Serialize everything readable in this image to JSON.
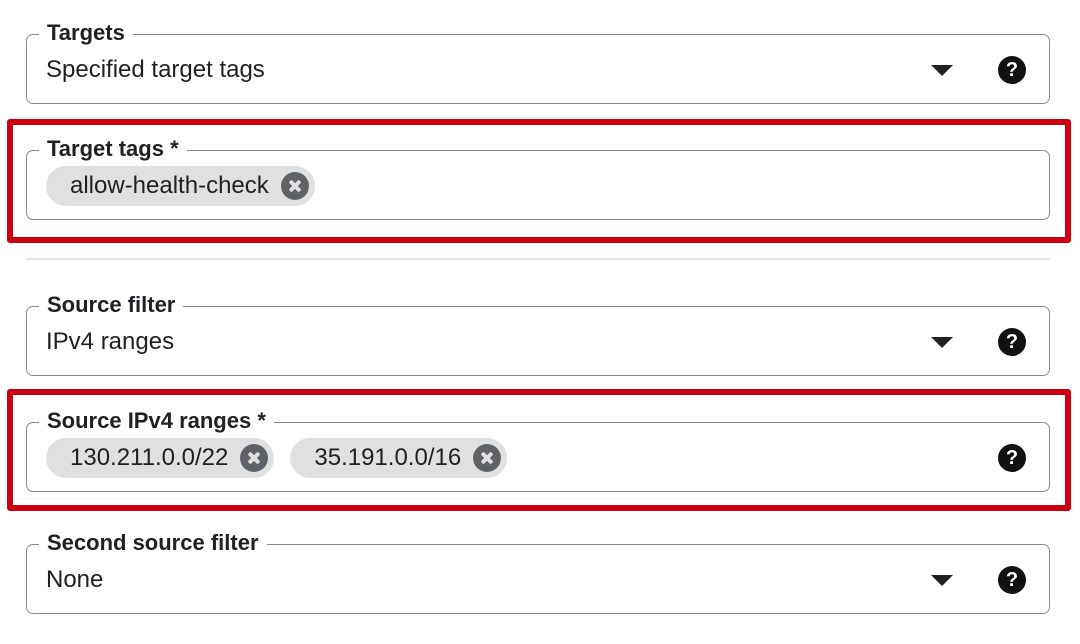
{
  "targets": {
    "label": "Targets",
    "value": "Specified target tags",
    "help_icon": "question-circle-icon",
    "dropdown_icon": "arrow-drop-down-icon"
  },
  "target_tags": {
    "label": "Target tags *",
    "chips": [
      "allow-health-check"
    ],
    "remove_icon": "cancel-icon"
  },
  "source_filter": {
    "label": "Source filter",
    "value": "IPv4 ranges",
    "help_icon": "question-circle-icon",
    "dropdown_icon": "arrow-drop-down-icon"
  },
  "source_ipv4_ranges": {
    "label": "Source IPv4 ranges *",
    "chips": [
      "130.211.0.0/22",
      "35.191.0.0/16"
    ],
    "help_icon": "question-circle-icon",
    "remove_icon": "cancel-icon"
  },
  "second_source_filter": {
    "label": "Second source filter",
    "value": "None",
    "help_icon": "question-circle-icon",
    "dropdown_icon": "arrow-drop-down-icon"
  },
  "colors": {
    "highlight": "#cc0011",
    "chip_background": "#e0e0e0",
    "field_border": "#8a8a8a"
  }
}
